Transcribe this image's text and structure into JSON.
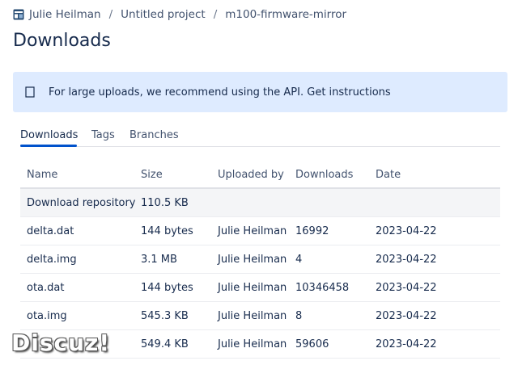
{
  "breadcrumb": {
    "items": [
      "Julie Heilman",
      "Untitled project",
      "m100-firmware-mirror"
    ],
    "separator": "/"
  },
  "page": {
    "title": "Downloads"
  },
  "banner": {
    "icon": "info-icon",
    "text": "For large uploads, we recommend using the API. Get instructions"
  },
  "tabs": [
    {
      "label": "Downloads",
      "active": true
    },
    {
      "label": "Tags",
      "active": false
    },
    {
      "label": "Branches",
      "active": false
    }
  ],
  "table": {
    "columns": [
      "Name",
      "Size",
      "Uploaded by",
      "Downloads",
      "Date"
    ],
    "rows": [
      [
        "Download repository",
        "110.5 KB",
        "",
        "",
        ""
      ],
      [
        "delta.dat",
        "144 bytes",
        "Julie Heilman",
        "16992",
        "2023-04-22"
      ],
      [
        "delta.img",
        "3.1 MB",
        "Julie Heilman",
        "4",
        "2023-04-22"
      ],
      [
        "ota.dat",
        "144 bytes",
        "Julie Heilman",
        "10346458",
        "2023-04-22"
      ],
      [
        "ota.img",
        "545.3 KB",
        "Julie Heilman",
        "8",
        "2023-04-22"
      ],
      [
        "",
        "549.4 KB",
        "Julie Heilman",
        "59606",
        "2023-04-22"
      ]
    ]
  },
  "watermark": "Discuz!",
  "colors": {
    "accent": "#0052cc",
    "banner_bg": "#deebff",
    "text": "#172b4d"
  }
}
